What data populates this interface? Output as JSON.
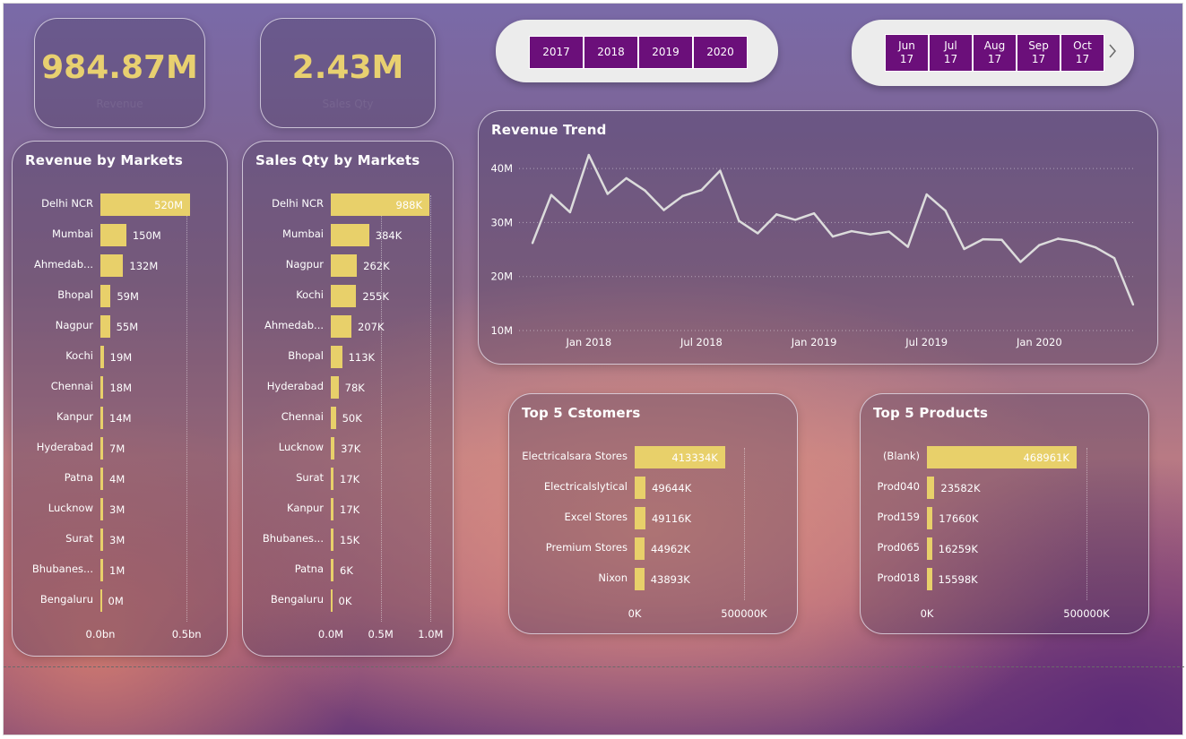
{
  "kpis": {
    "revenue": {
      "value": "984.87M",
      "sub": "Revenue"
    },
    "sales_qty": {
      "value": "2.43M",
      "sub": "Sales Qty"
    }
  },
  "year_slicer": [
    "2017",
    "2018",
    "2019",
    "2020"
  ],
  "month_slicer": [
    {
      "month": "Jun",
      "year": "17"
    },
    {
      "month": "Jul",
      "year": "17"
    },
    {
      "month": "Aug",
      "year": "17"
    },
    {
      "month": "Sep",
      "year": "17"
    },
    {
      "month": "Oct",
      "year": "17"
    }
  ],
  "next_icon": "chevron-right-icon",
  "colors": {
    "bar": "#e8d06a",
    "slicer": "#6b0f7a",
    "kpi": "#e8d070",
    "line": "#dcdcdc"
  },
  "chart_data": [
    {
      "id": "revenue_by_markets",
      "type": "bar",
      "orientation": "horizontal",
      "title": "Revenue by Markets",
      "categories": [
        "Delhi NCR",
        "Mumbai",
        "Ahmedab...",
        "Bhopal",
        "Nagpur",
        "Kochi",
        "Chennai",
        "Kanpur",
        "Hyderabad",
        "Patna",
        "Lucknow",
        "Surat",
        "Bhubanes...",
        "Bengaluru"
      ],
      "values": [
        520,
        150,
        132,
        59,
        55,
        19,
        18,
        14,
        7,
        4,
        3,
        3,
        1,
        0
      ],
      "value_labels": [
        "520M",
        "150M",
        "132M",
        "59M",
        "55M",
        "19M",
        "18M",
        "14M",
        "7M",
        "4M",
        "3M",
        "3M",
        "1M",
        "0M"
      ],
      "xlim": [
        0,
        520
      ],
      "ticks": [
        {
          "value": 0,
          "label": "0.0bn"
        },
        {
          "value": 500,
          "label": "0.5bn"
        }
      ]
    },
    {
      "id": "sales_qty_by_markets",
      "type": "bar",
      "orientation": "horizontal",
      "title": "Sales Qty by Markets",
      "categories": [
        "Delhi NCR",
        "Mumbai",
        "Nagpur",
        "Kochi",
        "Ahmedab...",
        "Bhopal",
        "Hyderabad",
        "Chennai",
        "Lucknow",
        "Surat",
        "Kanpur",
        "Bhubanes...",
        "Patna",
        "Bengaluru"
      ],
      "values": [
        988,
        384,
        262,
        255,
        207,
        113,
        78,
        50,
        37,
        17,
        17,
        15,
        6,
        0
      ],
      "value_labels": [
        "988K",
        "384K",
        "262K",
        "255K",
        "207K",
        "113K",
        "78K",
        "50K",
        "37K",
        "17K",
        "17K",
        "15K",
        "6K",
        "0K"
      ],
      "xlim": [
        0,
        988
      ],
      "ticks": [
        {
          "value": 0,
          "label": "0.0M"
        },
        {
          "value": 500,
          "label": "0.5M"
        },
        {
          "value": 1000,
          "label": "1.0M"
        }
      ]
    },
    {
      "id": "revenue_trend",
      "type": "line",
      "title": "Revenue Trend",
      "x": [
        "2017-10",
        "2017-11",
        "2017-12",
        "2018-01",
        "2018-02",
        "2018-03",
        "2018-04",
        "2018-05",
        "2018-06",
        "2018-07",
        "2018-08",
        "2018-09",
        "2018-10",
        "2018-11",
        "2018-12",
        "2019-01",
        "2019-02",
        "2019-03",
        "2019-04",
        "2019-05",
        "2019-06",
        "2019-07",
        "2019-08",
        "2019-09",
        "2019-10",
        "2019-11",
        "2019-12",
        "2020-01",
        "2020-02",
        "2020-03",
        "2020-04",
        "2020-05",
        "2020-06"
      ],
      "values": [
        26.2,
        35.1,
        31.9,
        42.5,
        35.3,
        38.2,
        35.9,
        32.3,
        34.9,
        36.0,
        39.6,
        30.3,
        28.0,
        31.5,
        30.5,
        31.7,
        27.4,
        28.4,
        27.8,
        28.3,
        25.5,
        35.2,
        32.2,
        25.1,
        26.9,
        26.8,
        22.7,
        25.8,
        27.0,
        26.5,
        25.4,
        23.4,
        14.8
      ],
      "ylim": [
        10,
        44
      ],
      "y_ticks": [
        {
          "value": 10,
          "label": "10M"
        },
        {
          "value": 20,
          "label": "20M"
        },
        {
          "value": 30,
          "label": "30M"
        },
        {
          "value": 40,
          "label": "40M"
        }
      ],
      "x_ticks": [
        {
          "x": "2018-01",
          "label": "Jan 2018"
        },
        {
          "x": "2018-07",
          "label": "Jul 2018"
        },
        {
          "x": "2019-01",
          "label": "Jan 2019"
        },
        {
          "x": "2019-07",
          "label": "Jul 2019"
        },
        {
          "x": "2020-01",
          "label": "Jan 2020"
        }
      ],
      "grid": true
    },
    {
      "id": "top5_customers",
      "type": "bar",
      "orientation": "horizontal",
      "title": "Top 5 Cstomers",
      "categories": [
        "Electricalsara Stores",
        "Electricalslytical",
        "Excel Stores",
        "Premium Stores",
        "Nixon"
      ],
      "values": [
        413334,
        49644,
        49116,
        44962,
        43893
      ],
      "value_labels": [
        "413334K",
        "49644K",
        "49116K",
        "44962K",
        "43893K"
      ],
      "xlim": [
        0,
        500000
      ],
      "ticks": [
        {
          "value": 0,
          "label": "0K"
        },
        {
          "value": 500000,
          "label": "500000K"
        }
      ]
    },
    {
      "id": "top5_products",
      "type": "bar",
      "orientation": "horizontal",
      "title": "Top 5 Products",
      "categories": [
        "(Blank)",
        "Prod040",
        "Prod159",
        "Prod065",
        "Prod018"
      ],
      "values": [
        468961,
        23582,
        17660,
        16259,
        15598
      ],
      "value_labels": [
        "468961K",
        "23582K",
        "17660K",
        "16259K",
        "15598K"
      ],
      "xlim": [
        0,
        500000
      ],
      "ticks": [
        {
          "value": 0,
          "label": "0K"
        },
        {
          "value": 500000,
          "label": "500000K"
        }
      ]
    }
  ]
}
